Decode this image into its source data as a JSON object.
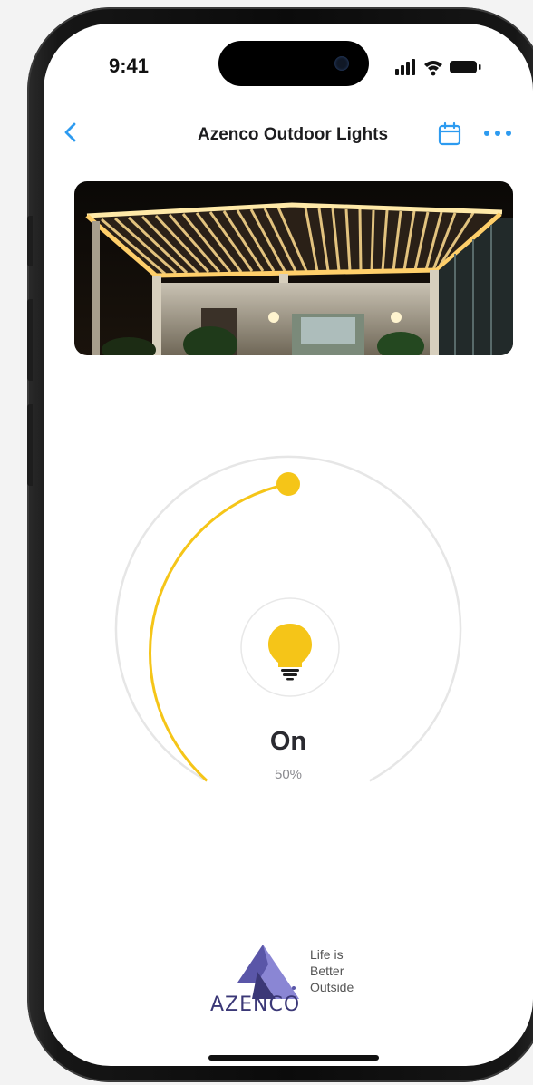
{
  "status_bar": {
    "time": "9:41",
    "icons": [
      "cellular-signal-icon",
      "wifi-icon",
      "battery-icon"
    ]
  },
  "nav": {
    "back_icon": "chevron-left-icon",
    "title": "Azenco Outdoor Lights",
    "calendar_icon": "calendar-icon",
    "more_icon": "ellipsis-icon"
  },
  "hero": {
    "image": "pergola-with-lights-photo"
  },
  "light_control": {
    "icon": "lightbulb-icon",
    "state": "On",
    "brightness_label": "50%",
    "brightness_fraction": 0.5
  },
  "brand": {
    "logo_word": "AZENCO",
    "tagline_lines": [
      "Life is",
      "Better",
      "Outside"
    ]
  },
  "colors": {
    "accent_blue": "#2d9bf0",
    "dial_yellow": "#f5c518",
    "dial_track": "#e6e6e6",
    "logo_purple": "#5a56a8"
  }
}
